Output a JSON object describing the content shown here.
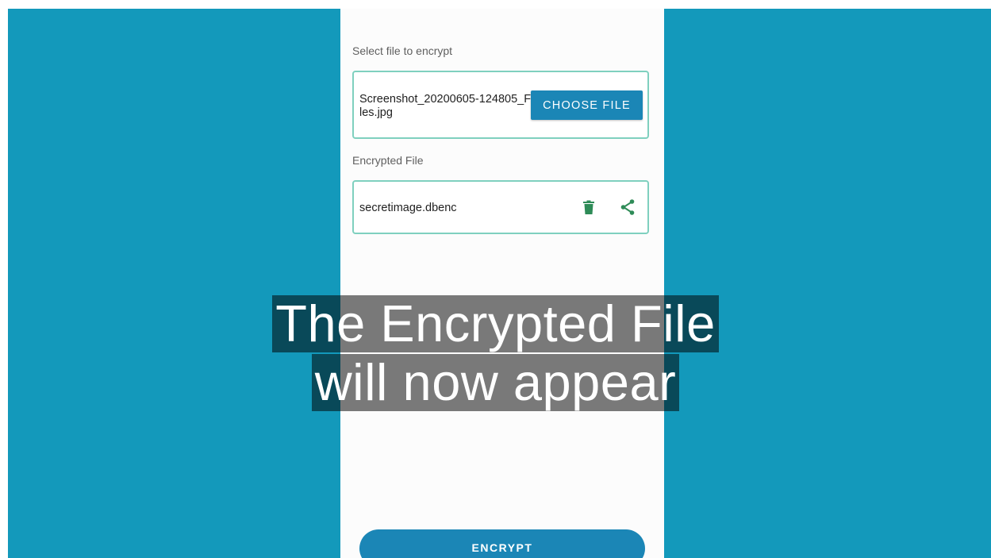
{
  "app": {
    "select_label": "Select file to encrypt",
    "selected_file_name": "Screenshot_20200605-124805_Files.jpg",
    "choose_file_label": "CHOOSE FILE",
    "encrypted_label": "Encrypted File",
    "encrypted_file_name": "secretimage.dbenc",
    "encrypt_label": "ENCRYPT"
  },
  "icons": {
    "delete": "trash-icon",
    "share": "share-icon"
  },
  "caption": {
    "line1": "The Encrypted File",
    "line2": "will  now appear"
  },
  "colors": {
    "background": "#1399bb",
    "accent": "#1b86b6",
    "card_border": "#7fd0bf",
    "icon_green": "#2e8b57"
  }
}
